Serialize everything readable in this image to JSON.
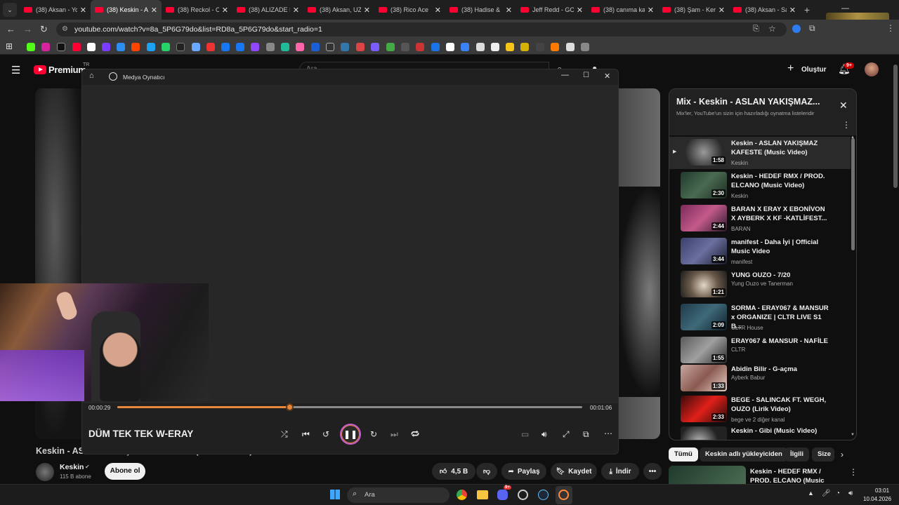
{
  "browser": {
    "tabs": [
      {
        "title": "(38) Aksan - Yo"
      },
      {
        "title": "(38) Keskin - A",
        "active": true
      },
      {
        "title": "(38) Reckol - O"
      },
      {
        "title": "(38) ALIZADE I"
      },
      {
        "title": "(38) Aksan, UZ"
      },
      {
        "title": "(38) Rico Ace"
      },
      {
        "title": "(38) Hadise &"
      },
      {
        "title": "Jeff Redd - GO"
      },
      {
        "title": "(38) canıma ka"
      },
      {
        "title": "(38) Şam - Ker"
      },
      {
        "title": "(38) Aksan - Sa"
      }
    ],
    "new_tab": "+",
    "url": "youtube.com/watch?v=8a_5P6G79do&list=RD8a_5P6G79do&start_radio=1"
  },
  "youtube": {
    "brand": "Premium",
    "country": "TR",
    "search_placeholder": "Ara",
    "create_label": "Oluştur",
    "notif_badge": "9+",
    "video_title": "Keskin - ASLAN YAKIŞMAZ KAFESTE (Music Video)",
    "channel_name": "Keskin",
    "subscribers": "115 B abone",
    "subscribe_label": "Abone ol",
    "likes": "4,5 B",
    "share_label": "Paylaş",
    "save_label": "Kaydet",
    "download_label": "İndir",
    "chips": [
      "Tümü",
      "Keskin adlı yükleyiciden",
      "İlgili",
      "Size"
    ],
    "next_video": {
      "title": "Keskin - HEDEF RMX / PROD. ELCANO (Music Video)"
    }
  },
  "playlist": {
    "title": "Mix - Keskin - ASLAN YAKIŞMAZ...",
    "subtitle": "Mix'ler, YouTube'un sizin için hazırladığı oynatma listeleridir",
    "items": [
      {
        "title": "Keskin - ASLAN YAKIŞMAZ KAFESTE (Music Video)",
        "channel": "Keskin",
        "duration": "1:58",
        "current": true
      },
      {
        "title": "Keskin - HEDEF RMX / PROD. ELCANO (Music Video)",
        "channel": "Keskin",
        "duration": "2:30"
      },
      {
        "title": "BARAN X ERAY X EBONİVON X AYBERK X KF -KATLİFEST...",
        "channel": "BARAN",
        "duration": "2:44"
      },
      {
        "title": "manifest - Daha İyi | Official Music Video",
        "channel": "manifest",
        "duration": "3:44"
      },
      {
        "title": "YUNG OUZO - 7/20",
        "channel": "Yung Ouzo ve Tanerman",
        "duration": "1:21"
      },
      {
        "title": "SORMA - ERAY067 & MANSUR x ORGANIZE | CLTR LIVE S1 B...",
        "channel": "CLTR House",
        "duration": "2:09"
      },
      {
        "title": "ERAY067 & MANSUR - NAFİLE",
        "channel": "CLTR",
        "duration": "1:55"
      },
      {
        "title": "Abidin Bilir - G-açma",
        "channel": "Ayberk Babur",
        "duration": "1:33"
      },
      {
        "title": "BEGE - SALINCAK FT. WEGH, OUZO (Lirik Video)",
        "channel": "bege ve 2 diğer kanal",
        "duration": "2:33"
      },
      {
        "title": "Keskin - Gibi (Music Video)",
        "channel": "Keskin",
        "duration": ""
      }
    ]
  },
  "media_player": {
    "app_title": "Medya Oynatıcı",
    "current_time": "00:00:29",
    "total_time": "00:01:06",
    "progress": 0.37,
    "track_title": "DÜM TEK TEK W-ERAY"
  },
  "taskbar": {
    "search_placeholder": "Ara",
    "discord_badge": "9+",
    "time": "03:01",
    "date": "10.04.2026"
  },
  "colors": {
    "youtube_red": "#ff0033",
    "player_accent": "#e8863a",
    "browser_bg": "#3a3a3a"
  }
}
